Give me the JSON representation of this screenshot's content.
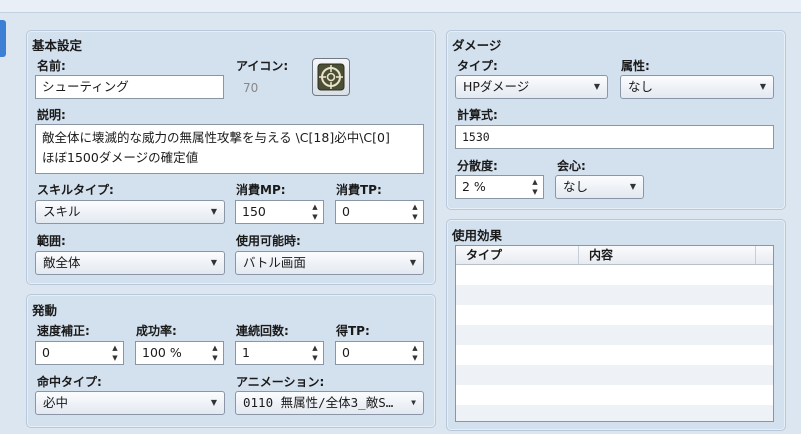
{
  "basic": {
    "title": "基本設定",
    "name_label": "名前:",
    "name_value": "シューティング",
    "icon_label": "アイコン:",
    "icon_index": "70",
    "desc_label": "説明:",
    "desc_line1": "敵全体に壊滅的な威力の無属性攻撃を与える \\C[18]必中\\C[0]",
    "desc_line2": "ほぼ1500ダメージの確定値",
    "skilltype_label": "スキルタイプ:",
    "skilltype_value": "スキル",
    "mp_label": "消費MP:",
    "mp_value": "150",
    "tp_label": "消費TP:",
    "tp_value": "0",
    "scope_label": "範囲:",
    "scope_value": "敵全体",
    "occasion_label": "使用可能時:",
    "occasion_value": "バトル画面"
  },
  "invocation": {
    "title": "発動",
    "speed_label": "速度補正:",
    "speed_value": "0",
    "success_label": "成功率:",
    "success_value": "100 %",
    "repeat_label": "連続回数:",
    "repeat_value": "1",
    "tpgain_label": "得TP:",
    "tpgain_value": "0",
    "hittype_label": "命中タイプ:",
    "hittype_value": "必中",
    "anim_label": "アニメーション:",
    "anim_value": "0110 無属性/全体3_敵S…"
  },
  "damage": {
    "title": "ダメージ",
    "type_label": "タイプ:",
    "type_value": "HPダメージ",
    "element_label": "属性:",
    "element_value": "なし",
    "formula_label": "計算式:",
    "formula_value": "1530",
    "variance_label": "分散度:",
    "variance_value": "2 %",
    "critical_label": "会心:",
    "critical_value": "なし"
  },
  "effects": {
    "title": "使用効果",
    "col_type": "タイプ",
    "col_content": "内容"
  },
  "icon_names": {
    "skill_icon": "crosshair-target-icon",
    "dropdown": "triangle-down",
    "spinner": "up-down-triangles"
  }
}
